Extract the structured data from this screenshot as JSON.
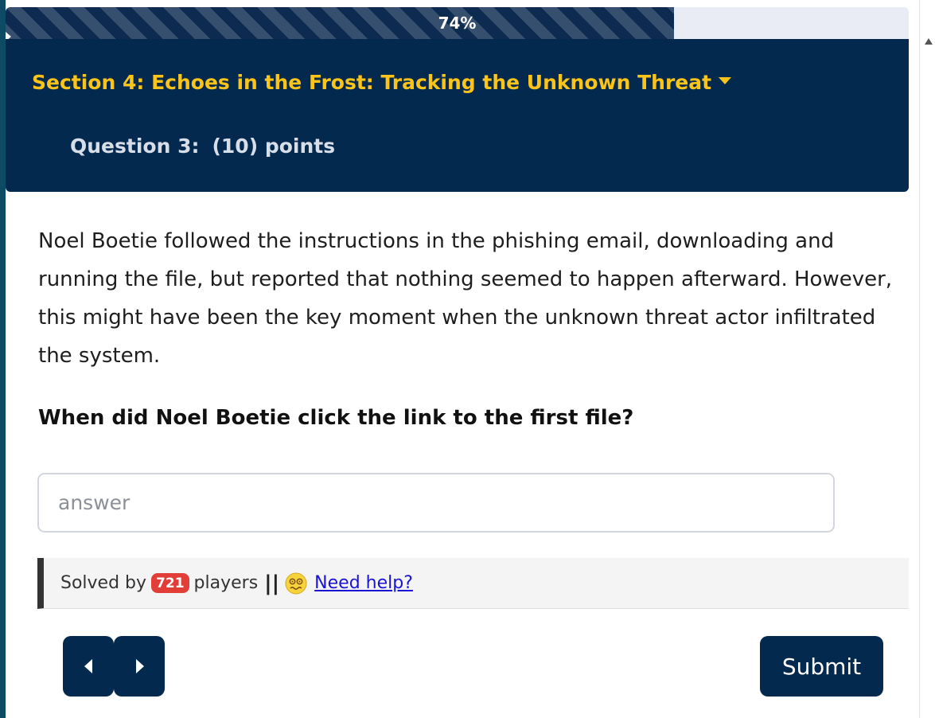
{
  "progress": {
    "percent": 74,
    "label": "74%"
  },
  "section": {
    "title": "Section 4: Echoes in the Frost: Tracking the Unknown Threat"
  },
  "question": {
    "number_label": "Question 3:",
    "points_label": "(10) points"
  },
  "body": {
    "text": "Noel Boetie followed the instructions in the phishing email, downloading and running the file, but reported that nothing seemed to happen afterward. However, this might have been the key moment when the unknown threat actor infiltrated the system.",
    "prompt": "When did Noel Boetie click the link to the first file?"
  },
  "answer": {
    "value": "",
    "placeholder": "answer"
  },
  "solved": {
    "prefix": "Solved by",
    "count": "721",
    "suffix": "players",
    "separator": "||",
    "help_icon": "woozy-face-icon",
    "help_label": "Need help?"
  },
  "nav": {
    "prev_icon": "triangle-left-icon",
    "next_icon": "triangle-right-icon"
  },
  "submit": {
    "label": "Submit"
  },
  "colors": {
    "navy": "#03294f",
    "gold": "#fcc419",
    "badge_red": "#e03e36",
    "link_blue": "#1a12d6",
    "progress_track": "#e9ecf4"
  }
}
